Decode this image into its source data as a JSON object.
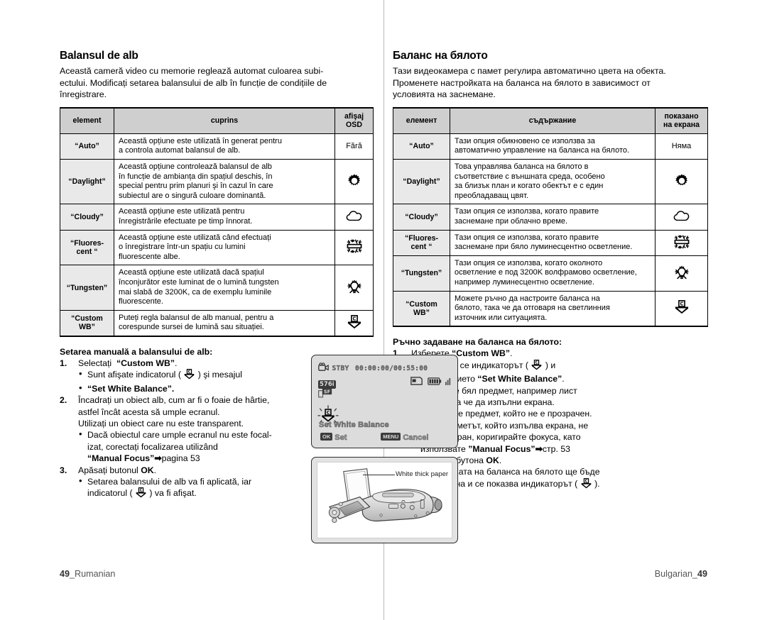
{
  "left": {
    "title": "Balansul de alb",
    "intro": [
      "Această cameră video cu memorie reglează automat culoarea subi-",
      "ectului. Modificați setarea balansului de alb în funcție de condițiile de",
      "înregistrare."
    ],
    "table": {
      "headers": [
        "element",
        "cuprins",
        "afişaj OSD"
      ],
      "header_osd_line1": "afişaj",
      "header_osd_line2": "OSD",
      "rows": [
        {
          "item": "“Auto”",
          "desc": [
            "Această opțiune este utilizată în generat pentru",
            "a controla automat balansul de alb."
          ],
          "osd_text": "Fără",
          "osd_icon": ""
        },
        {
          "item": "“Daylight”",
          "desc": [
            "Această opțiune controlează balansul de alb",
            "în funcție de ambianța din spațiul deschis, în",
            "special pentru prim planuri şi în cazul în care",
            "subiectul are o singură culoare dominantă."
          ],
          "osd_text": "",
          "osd_icon": "sun-icon"
        },
        {
          "item": "“Cloudy”",
          "desc": [
            "Această opțiune este utilizată pentru",
            "înregistrările efectuate pe timp înnorat."
          ],
          "osd_text": "",
          "osd_icon": "cloud-icon"
        },
        {
          "item": "“Fluores-\ncent “",
          "item_l1": "“Fluores-",
          "item_l2": "cent “",
          "desc": [
            "Această opțiune este utilizată când efectuați",
            "o înregistrare într-un spațiu cu lumini",
            "fluorescente albe."
          ],
          "osd_text": "",
          "osd_icon": "fluorescent-icon"
        },
        {
          "item": "“Tungsten”",
          "desc": [
            "Această opțiune este utilizată dacă spațiul",
            "înconjurător este luminat de o lumină tungsten",
            "mai slabă de 3200K, ca de exemplu luminile",
            "fluorescente."
          ],
          "osd_text": "",
          "osd_icon": "tungsten-icon"
        },
        {
          "item_l1": "“Custom",
          "item_l2": "WB”",
          "desc": [
            "Puteți regla balansul de alb manual, pentru a",
            "corespunde sursei de lumină sau situației."
          ],
          "osd_text": "",
          "osd_icon": "custom-wb-icon"
        }
      ]
    },
    "proc_title": "Setarea manuală a balansului de alb:",
    "steps": [
      {
        "num": "1.",
        "lines": [
          "Selectați  “Custom WB”."
        ],
        "bullets": [
          {
            "pre": "Sunt afişate indicatorul ( ",
            "icon": "custom-wb-icon",
            "post": " ) şi mesajul"
          },
          {
            "bold_line": "“Set White Balance”."
          }
        ]
      },
      {
        "num": "2.",
        "lines": [
          "Încadrați un obiect alb, cum ar fi o foaie de hârtie,",
          "astfel încât acesta să umple ecranul.",
          "Utilizați un obiect care nu este transparent."
        ],
        "bullets": [
          {
            "plain": "Dacă obiectul care umple ecranul nu este focal-"
          },
          {
            "plain": "izat, corectați focalizarea utilizând"
          },
          {
            "bold": "“Manual  Focus”",
            "arrow": "➡",
            "tail": "pagina 53"
          }
        ]
      },
      {
        "num": "3.",
        "lines_rich": {
          "pre": "Apăsați butonul ",
          "bold": "OK",
          "post": "."
        },
        "bullets": [
          {
            "plain": "Setarea balansului de alb va fi aplicată, iar"
          },
          {
            "pre": "indicatorul ( ",
            "icon": "custom-wb-icon",
            "post": " ) va fi afişat."
          }
        ]
      }
    ],
    "footer": {
      "num": "49",
      "lang": "_Rumanian"
    }
  },
  "right": {
    "title": "Баланс на бялото",
    "intro": [
      "Тази видеокамера с памет регулира автоматично цвета на обекта.",
      "Променете настройката на баланса на бялото в зависимост от",
      "условията на заснемане."
    ],
    "table": {
      "headers": [
        "елемент",
        "съдържание",
        "показано на екрана"
      ],
      "header_osd_line1": "показано",
      "header_osd_line2": "на екрана",
      "rows": [
        {
          "item": "“Auto”",
          "desc": [
            "Тази опция обикновено се използва за",
            "автоматично управление на баланса на бялото."
          ],
          "osd_text": "Няма",
          "osd_icon": ""
        },
        {
          "item": "“Daylight”",
          "desc": [
            "Това управлява баланса на бялото в",
            "съответствие с външната среда, особено",
            "за близък план и когато обектът е с един",
            "преобладаващ цвят."
          ],
          "osd_text": "",
          "osd_icon": "sun-icon"
        },
        {
          "item": "“Cloudy”",
          "desc": [
            "Тази опция се използва, когато правите",
            "заснемане при облачно време."
          ],
          "osd_text": "",
          "osd_icon": "cloud-icon"
        },
        {
          "item_l1": "“Fluores-",
          "item_l2": "cent “",
          "desc": [
            "Тази опция се използва, когато правите",
            "заснемане при бяло луминесцентно осветление."
          ],
          "osd_text": "",
          "osd_icon": "fluorescent-icon"
        },
        {
          "item": "“Tungsten”",
          "desc": [
            "Тази опция се използва, когато околното",
            "осветление е под 3200K волфрамово осветление,",
            "например луминесцентно осветление."
          ],
          "osd_text": "",
          "osd_icon": "tungsten-icon"
        },
        {
          "item_l1": "“Custom",
          "item_l2": "WB”",
          "desc": [
            "Можете ръчно да настроите баланса на",
            "бялото, така че да отговаря на светлинния",
            "източник или ситуацията."
          ],
          "osd_text": "",
          "osd_icon": "custom-wb-icon"
        }
      ]
    },
    "proc_title": "Ръчно задаване на баланса на бялото:",
    "steps": [
      {
        "num": "1.",
        "lines": [
          "Изберете “Custom WB”."
        ],
        "bullets": [
          {
            "pre": "Показват се индикаторът ( ",
            "icon": "custom-wb-icon",
            "post": " ) и"
          },
          {
            "pre2": "съобщението ",
            "bold": "“Set White Balance”",
            "post2": "."
          }
        ]
      },
      {
        "num": "2.",
        "lines": [
          "Кадрирайте бял предмет, например лист",
          "хартия, така че да изпълни екрана.",
          "Използвайте предмет, който не е прозрачен."
        ],
        "bullets": [
          {
            "plain": "Ако предметът, който изпълва екрана, не"
          },
          {
            "plain": "е фокусиран, коригирайте фокуса, като"
          },
          {
            "pre": "използвате ",
            "bold": "”Manual  Focus”",
            "arrow": "➡",
            "tail": "стр. 53"
          }
        ]
      },
      {
        "num": "3.",
        "lines_rich": {
          "pre": "Натиснете бутона ",
          "bold": "OK",
          "post": "."
        },
        "bullets": [
          {
            "plain": "Настройката на баланса на бялото ще бъде"
          },
          {
            "pre": "приложена и се показва индикаторът ( ",
            "icon": "custom-wb-icon",
            "post": " )."
          }
        ]
      }
    ],
    "footer": {
      "lang": "Bulgarian_",
      "num": "49"
    }
  },
  "illustration": {
    "lcd": {
      "stby": "STBY",
      "timecode": "00:00:00/00:55:00",
      "quality_576i": "576i",
      "quality_sf": "SF",
      "message": "Set White Balance",
      "ok_tag": "OK",
      "ok_label": "Set",
      "menu_tag": "MENU",
      "menu_label": "Cancel"
    },
    "photo": {
      "callout": "White thick paper"
    }
  }
}
